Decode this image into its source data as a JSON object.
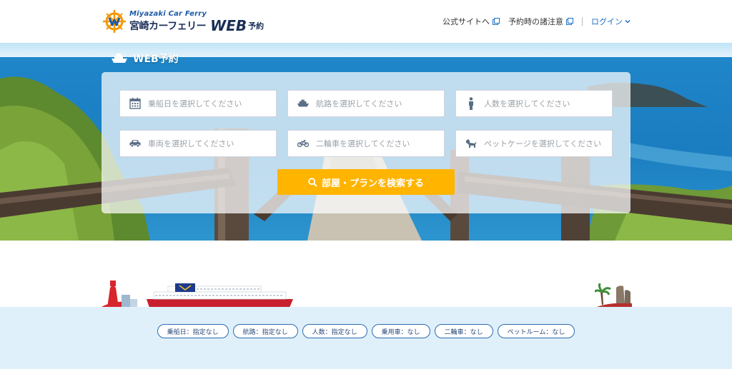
{
  "header": {
    "logo_en": "Miyazaki Car Ferry",
    "logo_ja": "宮崎カーフェリー",
    "logo_web": "WEB",
    "logo_yoyaku": "予約",
    "nav": {
      "official_site": "公式サイトへ",
      "notes": "予約時の諸注意",
      "login": "ログイン"
    }
  },
  "booking": {
    "section_title": "WEB予約",
    "fields": {
      "date": "乗船日を選択してください",
      "route": "航路を選択してください",
      "people": "人数を選択してください",
      "vehicle": "車両を選択してください",
      "bike": "二輪車を選択してください",
      "pet": "ペットケージを選択してください"
    },
    "search_label": "部屋・プランを検索する"
  },
  "summary": {
    "chips": [
      "乗船日：指定なし",
      "航路：指定なし",
      "人数：指定なし",
      "乗用車：なし",
      "二輪車：なし",
      "ペットルーム：なし"
    ]
  },
  "colors": {
    "accent": "#ffb400",
    "brand": "#1a2e57",
    "link": "#1d6fc4",
    "summary_bg": "#dff0fb"
  },
  "icons": [
    "logo-compass-icon",
    "external-link-icon",
    "chevron-down-icon",
    "ship-icon",
    "calendar-icon",
    "person-icon",
    "car-icon",
    "motorcycle-icon",
    "dog-icon",
    "search-icon"
  ]
}
